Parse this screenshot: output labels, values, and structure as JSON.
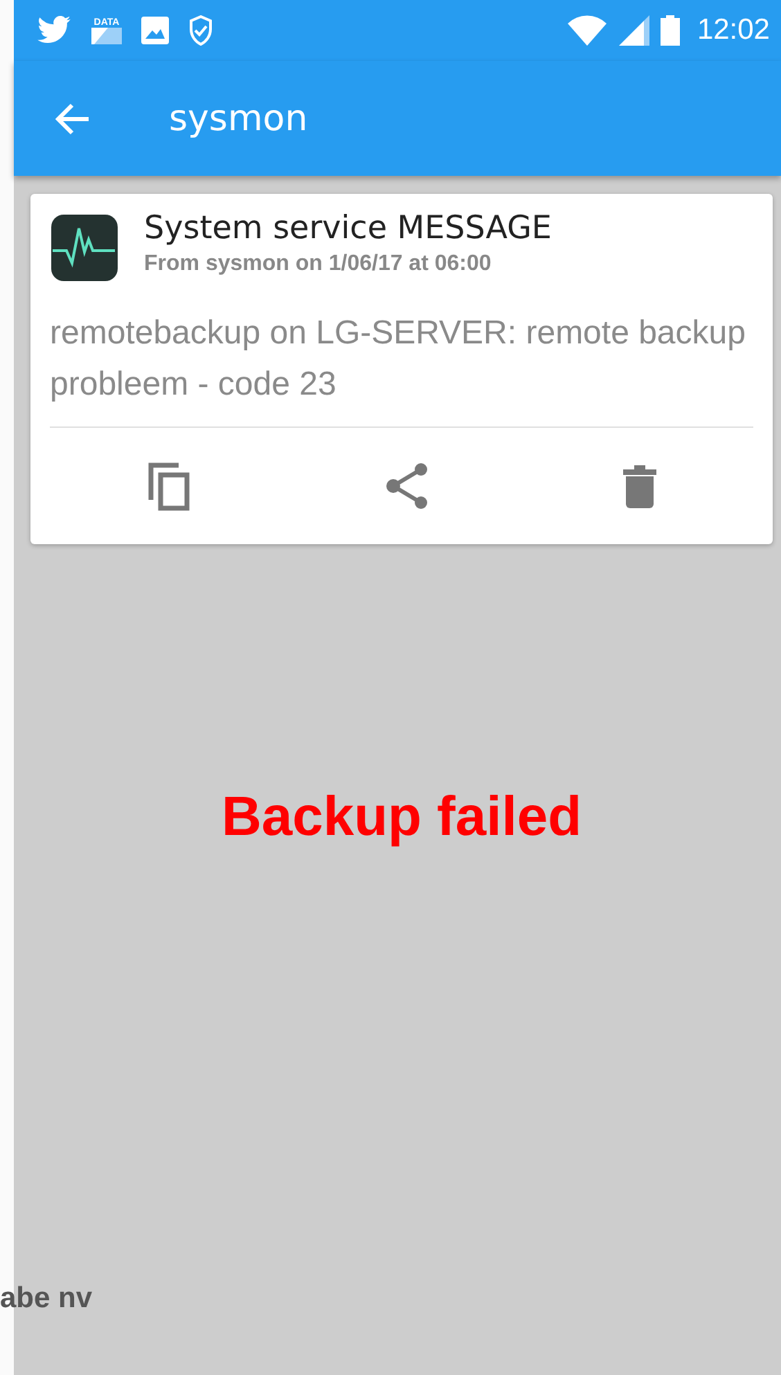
{
  "status_bar": {
    "data_label": "DATA",
    "time": "12:02"
  },
  "app_bar": {
    "title": "sysmon"
  },
  "notification": {
    "title": "System service MESSAGE",
    "subtitle": "From sysmon on 1/06/17 at 06:00",
    "body": "remotebackup on LG-SERVER: remote backup probleem - code 23"
  },
  "overlay_text": "Backup failed",
  "side_text": "abe nv"
}
